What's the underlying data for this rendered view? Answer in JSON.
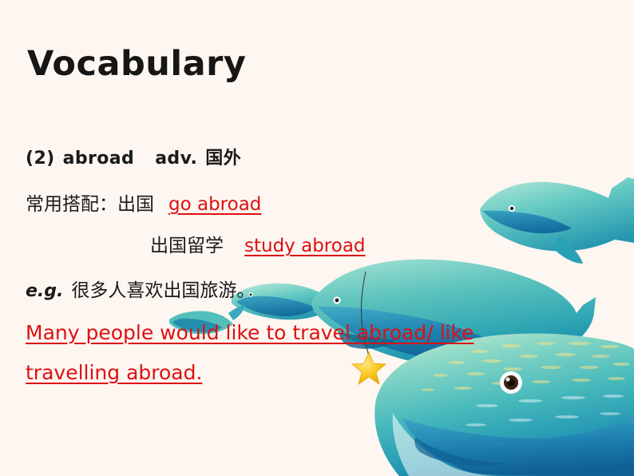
{
  "slide": {
    "background_color": "#fdf6f1",
    "title": "Vocabulary"
  },
  "content": {
    "entry_line": {
      "number": "(2)",
      "word": "abroad",
      "part_of_speech": "adv.",
      "chinese_gloss": "国外"
    },
    "collocations": {
      "label": "常用搭配：",
      "items": [
        {
          "chinese": "出国",
          "english": "go abroad"
        },
        {
          "chinese": "出国留学",
          "english": "study abroad"
        }
      ]
    },
    "example": {
      "label": "e.g.",
      "chinese_sentence": "很多人喜欢出国旅游。",
      "english_line_1": "Many people would like to travel abroad/ like",
      "english_line_2": "travelling abroad."
    }
  },
  "style": {
    "title_color": "#161616",
    "body_color": "#1a1a1a",
    "highlight_color": "#dd1111"
  },
  "illustration": {
    "name": "whale-pod-illustration",
    "description": "Teal whales swimming, a hanging yellow star on a fishing line",
    "whale_color_light": "#8fd9cf",
    "whale_color_mid": "#47b8b4",
    "whale_color_dark": "#1f8fae",
    "whale_color_deep": "#1173a6",
    "star_color": "#f5c518",
    "line_color": "#4a4a4a",
    "whales": [
      {
        "name": "whale-top-right",
        "size": "small"
      },
      {
        "name": "whale-mid-tiny",
        "size": "tiny"
      },
      {
        "name": "whale-middle",
        "size": "medium"
      },
      {
        "name": "whale-left-tiny",
        "size": "tiny"
      },
      {
        "name": "whale-foreground",
        "size": "large"
      }
    ]
  }
}
